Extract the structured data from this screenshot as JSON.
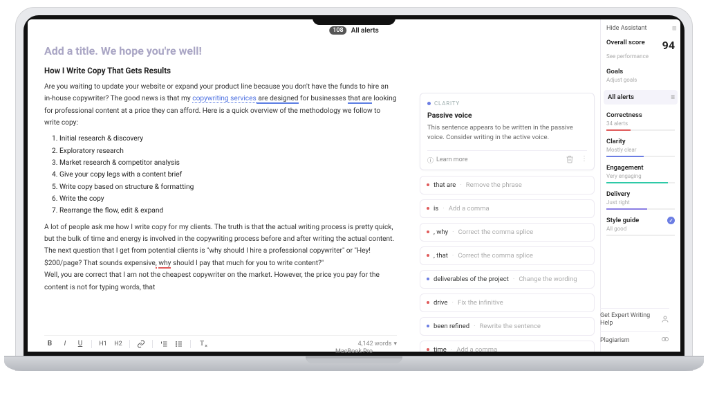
{
  "header": {
    "badge": "108",
    "label": "All alerts"
  },
  "editor": {
    "title_prompt": "Add a title. We hope you're well!",
    "subtitle": "How I Write Copy That Gets Results",
    "para1_a": "Are you waiting to update your website or expand your product line because you don't have the funds to hire an in-house copywriter? The good news is that my ",
    "link1": "copywriting services",
    "span_designed": " are designed",
    "para1_b": " for businesses ",
    "span_thatare": "that are",
    "para1_c": " looking for professional content at a price they can afford. Here is a quick overview of the methodology we follow to write copy:",
    "steps": [
      "Initial research & discovery",
      "Exploratory research",
      "Market research & competitor analysis",
      "Give your copy legs with a content brief",
      "Write copy based on structure & formatting",
      "Write the copy",
      "Rearrange the flow, edit & expand"
    ],
    "para2": "A lot of people ask me how I write copy for my clients. The truth is that the actual writing process is pretty quick, but the bulk of time and energy is involved in the copywriting process before and after writing the actual content.",
    "para3_a": "The next question that I get from potential clients is \"why should I hire a professional copywriter\" or \"Hey! $200/page? That sounds expensive",
    "para3_comma": ",",
    "para3_b": " ",
    "para3_why": "why",
    "para3_c": " should I pay that much for you to write content?\"",
    "para4": "Well, you are correct that I am not the cheapest copywriter on the market. However, the price you pay for the content is not for typing words, that",
    "wordcount": "4,142 words"
  },
  "alert": {
    "category": "CLARITY",
    "title": "Passive voice",
    "desc": "This sentence appears to be written in the passive voice. Consider writing in the active voice.",
    "learn": "Learn more"
  },
  "minis": [
    {
      "color": "d-red",
      "phrase": "that are",
      "hint": "Remove the phrase"
    },
    {
      "color": "d-red",
      "phrase": "is",
      "hint": "Add a comma"
    },
    {
      "color": "d-red",
      "phrase": ", why",
      "hint": "Correct the comma splice"
    },
    {
      "color": "d-red",
      "phrase": ", that",
      "hint": "Correct the comma splice"
    },
    {
      "color": "d-blue",
      "phrase": "deliverables of the project",
      "hint": "Change the wording"
    },
    {
      "color": "d-red",
      "phrase": "drive",
      "hint": "Fix the infinitive"
    },
    {
      "color": "d-blue",
      "phrase": "been refined",
      "hint": "Rewrite the sentence"
    },
    {
      "color": "d-red",
      "phrase": "time",
      "hint": "Add a comma"
    }
  ],
  "sidebar": {
    "hide": "Hide Assistant",
    "score_label": "Overall score",
    "score": "94",
    "score_sub": "See performance",
    "goals": "Goals",
    "goals_sub": "Adjust goals",
    "all_alerts": "All alerts",
    "correctness": "Correctness",
    "correctness_sub": "34 alerts",
    "clarity": "Clarity",
    "clarity_sub": "Mostly clear",
    "engagement": "Engagement",
    "engagement_sub": "Very engaging",
    "delivery": "Delivery",
    "delivery_sub": "Just right",
    "style": "Style guide",
    "style_sub": "All good",
    "expert": "Get Expert Writing Help",
    "plagiarism": "Plagiarism"
  },
  "device": {
    "brand": "MacBook Pro"
  }
}
